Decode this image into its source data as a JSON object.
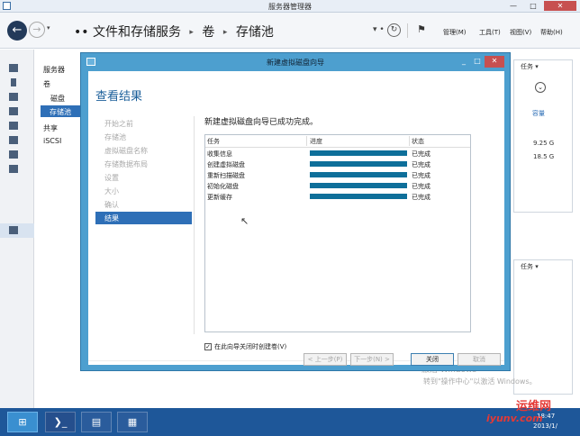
{
  "window": {
    "title": "服务器管理器",
    "min_glyph": "—",
    "max_glyph": "□",
    "close_glyph": "✕"
  },
  "nav": {
    "back_glyph": "←",
    "forward_glyph": "→",
    "dropdown_glyph": "▾",
    "breadcrumb_prefix": "••",
    "breadcrumb": [
      "文件和存储服务",
      "卷",
      "存储池"
    ],
    "breadcrumb_sep": "▸",
    "tools_glyph": "▾ •",
    "refresh_glyph": "↻",
    "flag_glyph": "⚑",
    "menus": [
      "管理(M)",
      "工具(T)",
      "视图(V)",
      "帮助(H)"
    ]
  },
  "sidenav": {
    "items": [
      "服务器",
      "卷",
      "磁盘",
      "存储池",
      "共享",
      "iSCSI"
    ]
  },
  "right_panel": {
    "task_label_1": "任务",
    "task_label_2": "任务",
    "dropdown_glyph": "▾",
    "circle_glyph": "⌄",
    "capacity_label": "容量",
    "value_1": "9.25 G",
    "value_2": "18.5 G"
  },
  "dialog": {
    "title": "新建虚拟磁盘向导",
    "min_glyph": "_",
    "max_glyph": "□",
    "close_glyph": "✕",
    "heading": "查看结果",
    "steps": [
      "开始之前",
      "存储池",
      "虚拟磁盘名称",
      "存储数据布局",
      "设置",
      "大小",
      "确认",
      "结果"
    ],
    "active_step": "结果",
    "result_message": "新建虚拟磁盘向导已成功完成。",
    "table": {
      "columns": [
        "任务",
        "进度",
        "状态"
      ],
      "rows": [
        {
          "task": "收集信息",
          "progress": 100,
          "status": "已完成"
        },
        {
          "task": "创建虚拟磁盘",
          "progress": 100,
          "status": "已完成"
        },
        {
          "task": "重新扫描磁盘",
          "progress": 100,
          "status": "已完成"
        },
        {
          "task": "初始化磁盘",
          "progress": 100,
          "status": "已完成"
        },
        {
          "task": "更新缓存",
          "progress": 100,
          "status": "已完成"
        }
      ]
    },
    "checkbox": {
      "label": "在此向导关闭时创建卷(V)",
      "checked": true,
      "glyph": "✓"
    },
    "buttons": {
      "prev": "< 上一步(P)",
      "next": "下一步(N) >",
      "close": "关闭",
      "cancel": "取消"
    }
  },
  "watermark": {
    "line1": "激活 Windows",
    "line2": "转到\"操作中心\"以激活 Windows。",
    "logo": "运维网",
    "url": "iyunv.com"
  },
  "taskbar": {
    "powershell_glyph": "❯_",
    "explorer_glyph": "▤",
    "servermgr_glyph": "▦",
    "time": "18:47",
    "date": "2013/1/"
  },
  "colors": {
    "accent": "#2e6fb7",
    "dialog_frame": "#4d9fcf",
    "progress_fill": "#0e6f9a",
    "taskbar": "#1e5799",
    "close_button": "#c75050"
  }
}
